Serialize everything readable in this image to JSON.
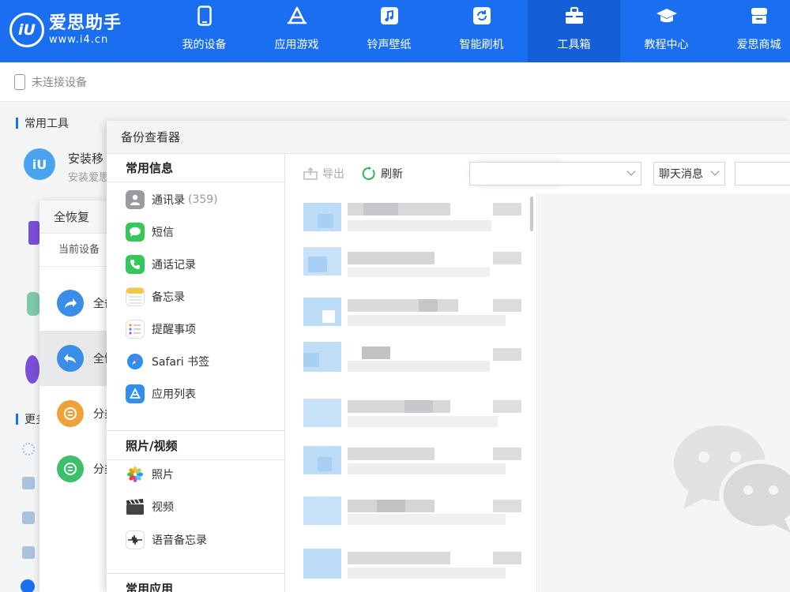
{
  "app": {
    "logo_badge": "iU",
    "logo_name": "爱思助手",
    "logo_url": "www.i4.cn",
    "brand_color": "#1a6ff0"
  },
  "nav": {
    "items": [
      {
        "label": "我的设备",
        "icon": "phone-icon"
      },
      {
        "label": "应用游戏",
        "icon": "appstore-icon"
      },
      {
        "label": "铃声壁纸",
        "icon": "music-icon"
      },
      {
        "label": "智能刷机",
        "icon": "refresh-icon"
      },
      {
        "label": "工具箱",
        "icon": "toolbox-icon",
        "active": true
      },
      {
        "label": "教程中心",
        "icon": "graduation-cap-icon"
      },
      {
        "label": "爱思商城",
        "icon": "store-icon"
      }
    ]
  },
  "subbar": {
    "device_status": "未连接设备"
  },
  "tools": {
    "common_title": "常用工具",
    "more_title": "更多",
    "install_name": "安装移",
    "install_desc": "安装爱思"
  },
  "restore": {
    "title": "全恢复",
    "current_device": "当前设备",
    "items": [
      {
        "label": "全备",
        "color": "#3a8ee8",
        "icon": "share-arrow-icon"
      },
      {
        "label": "全恢",
        "color": "#3a8ee8",
        "icon": "reply-arrow-icon",
        "selected": true
      },
      {
        "label": "分类",
        "color": "#f0a23a",
        "icon": "backup-category-icon"
      },
      {
        "label": "分类",
        "color": "#3ebf6b",
        "icon": "restore-category-icon"
      }
    ]
  },
  "viewer": {
    "title": "备份查看器",
    "groups": [
      {
        "title": "常用信息",
        "items": [
          {
            "label": "通讯录",
            "count": "(359)",
            "icon": "contacts-icon",
            "color": "#8e8e93"
          },
          {
            "label": "短信",
            "icon": "messages-icon",
            "color": "#34c759"
          },
          {
            "label": "通话记录",
            "icon": "phone-call-icon",
            "color": "#34c759"
          },
          {
            "label": "备忘录",
            "icon": "notes-icon",
            "color": "#f5c842"
          },
          {
            "label": "提醒事项",
            "icon": "reminders-icon",
            "color": "#ffffff"
          },
          {
            "label": "Safari 书签",
            "icon": "safari-icon",
            "color": "#2f8ff0"
          },
          {
            "label": "应用列表",
            "icon": "appstore-icon",
            "color": "#2f8ff0"
          }
        ]
      },
      {
        "title": "照片/视频",
        "items": [
          {
            "label": "照片",
            "icon": "photos-icon",
            "color": "#ffffff"
          },
          {
            "label": "视频",
            "icon": "video-clapper-icon",
            "color": "#333333"
          },
          {
            "label": "语音备忘录",
            "icon": "voice-memo-icon",
            "color": "#ffffff"
          }
        ]
      },
      {
        "title": "常用应用",
        "items": []
      }
    ],
    "toolbar": {
      "export_label": "导出",
      "refresh_label": "刷新",
      "filter_value": "聊天消息",
      "search_placeholder": ""
    }
  }
}
